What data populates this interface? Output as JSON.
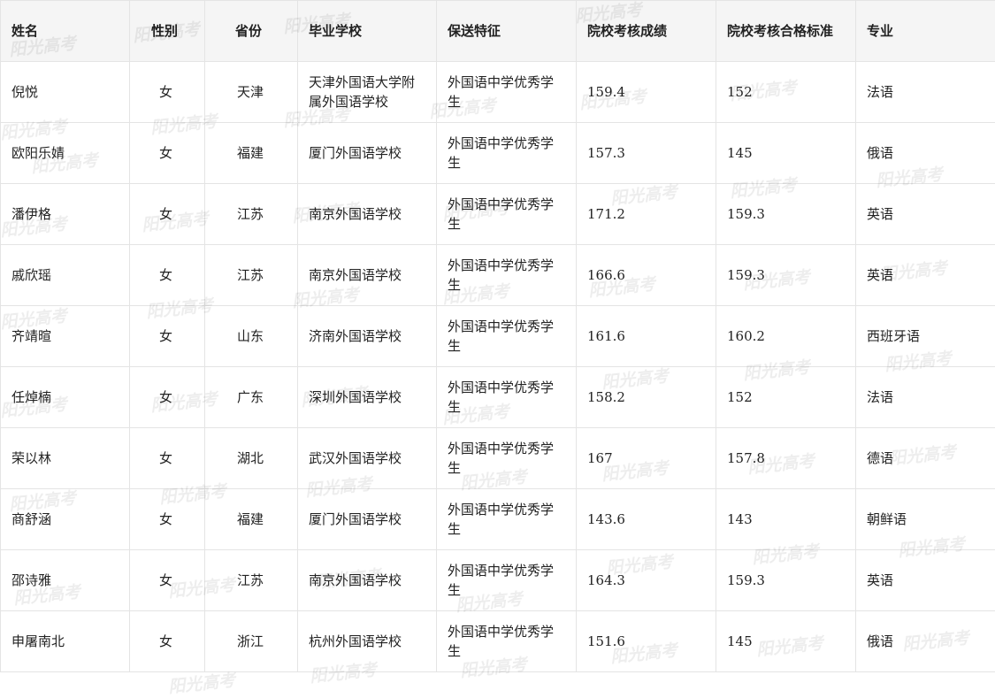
{
  "table": {
    "headers": [
      "姓名",
      "性别",
      "省份",
      "毕业学校",
      "保送特征",
      "院校考核成绩",
      "院校考核合格标准",
      "专业"
    ],
    "rows": [
      [
        "倪悦",
        "女",
        "天津",
        "天津外国语大学附属外国语学校",
        "外国语中学优秀学生",
        "159.4",
        "152",
        "法语"
      ],
      [
        "欧阳乐婧",
        "女",
        "福建",
        "厦门外国语学校",
        "外国语中学优秀学生",
        "157.3",
        "145",
        "俄语"
      ],
      [
        "潘伊格",
        "女",
        "江苏",
        "南京外国语学校",
        "外国语中学优秀学生",
        "171.2",
        "159.3",
        "英语"
      ],
      [
        "戚欣瑶",
        "女",
        "江苏",
        "南京外国语学校",
        "外国语中学优秀学生",
        "166.6",
        "159.3",
        "英语"
      ],
      [
        "齐靖暄",
        "女",
        "山东",
        "济南外国语学校",
        "外国语中学优秀学生",
        "161.6",
        "160.2",
        "西班牙语"
      ],
      [
        "任焯楠",
        "女",
        "广东",
        "深圳外国语学校",
        "外国语中学优秀学生",
        "158.2",
        "152",
        "法语"
      ],
      [
        "荣以林",
        "女",
        "湖北",
        "武汉外国语学校",
        "外国语中学优秀学生",
        "167",
        "157.8",
        "德语"
      ],
      [
        "商舒涵",
        "女",
        "福建",
        "厦门外国语学校",
        "外国语中学优秀学生",
        "143.6",
        "143",
        "朝鲜语"
      ],
      [
        "邵诗雅",
        "女",
        "江苏",
        "南京外国语学校",
        "外国语中学优秀学生",
        "164.3",
        "159.3",
        "英语"
      ],
      [
        "申屠南北",
        "女",
        "浙江",
        "杭州外国语学校",
        "外国语中学优秀学生",
        "151.6",
        "145",
        "俄语"
      ]
    ]
  },
  "watermark": "阳光高考"
}
